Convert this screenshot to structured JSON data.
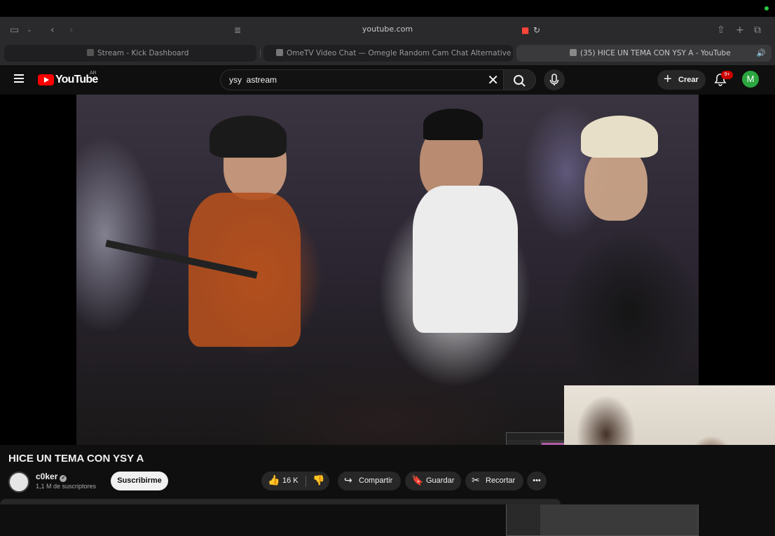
{
  "browser": {
    "url": "youtube.com",
    "tabs": [
      {
        "label": "Stream - Kick Dashboard",
        "active": false,
        "icon": "kick-icon"
      },
      {
        "label": "OmeTV Video Chat — Omegle Random Cam Chat Alternative 2025",
        "active": false,
        "icon": "ometv-icon"
      },
      {
        "label": "(35) HICE UN TEMA CON YSY A - YouTube",
        "active": true,
        "icon": "youtube-icon"
      }
    ]
  },
  "header": {
    "logo_text": "YouTube",
    "region": "AR",
    "search_value": "ysy  astream",
    "create_label": "Crear",
    "notifications_badge": "9+",
    "avatar_letter": "M"
  },
  "video": {
    "title": "HICE UN TEMA CON YSY A",
    "channel_name": "c0ker",
    "subscribers": "1,1 M de suscriptores",
    "subscribe_label": "Suscribirme",
    "likes": "16 K",
    "share_label": "Compartir",
    "save_label": "Guardar",
    "clip_label": "Recortar"
  },
  "colors": {
    "brand_red": "#ff0000",
    "background": "#0f0f0f",
    "avatar_green": "#2ba640",
    "badge_red": "#cc0000"
  }
}
